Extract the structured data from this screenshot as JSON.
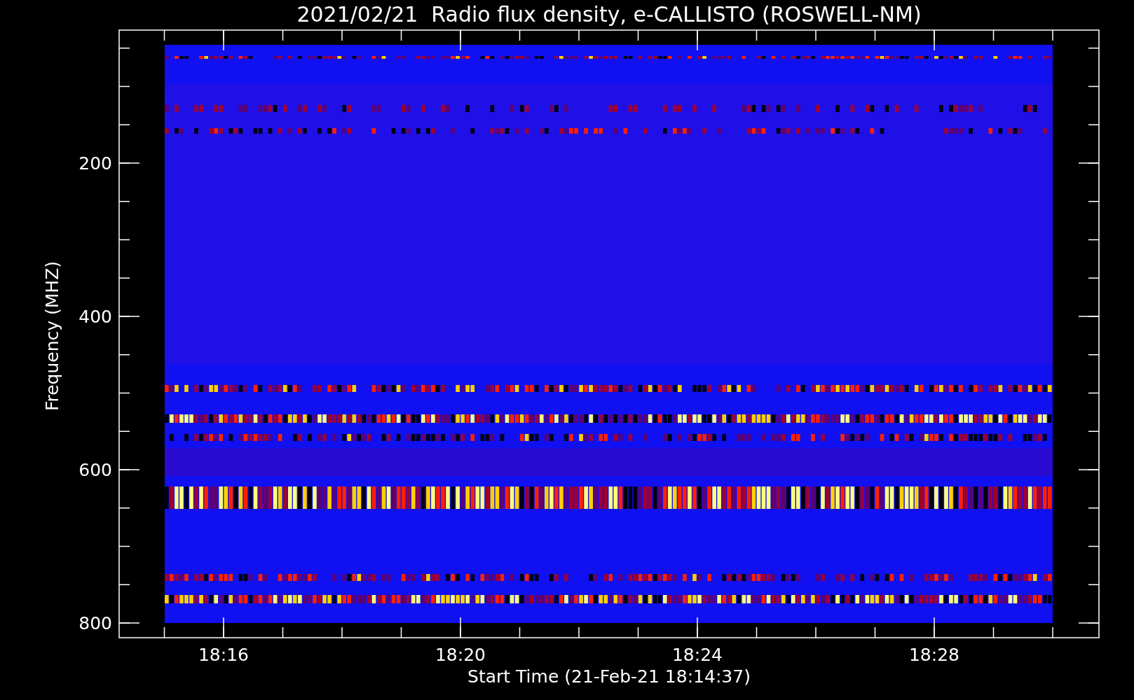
{
  "title": "2021/02/21  Radio flux density, e-CALLISTO (ROSWELL-NM)",
  "y_axis": {
    "title": "Frequency (MHZ)",
    "tick_labels": [
      "200",
      "400",
      "600",
      "800"
    ]
  },
  "x_axis": {
    "title": "Start Time (21-Feb-21 18:14:37)",
    "tick_labels": [
      "18:16",
      "18:20",
      "18:24",
      "18:28"
    ]
  }
}
